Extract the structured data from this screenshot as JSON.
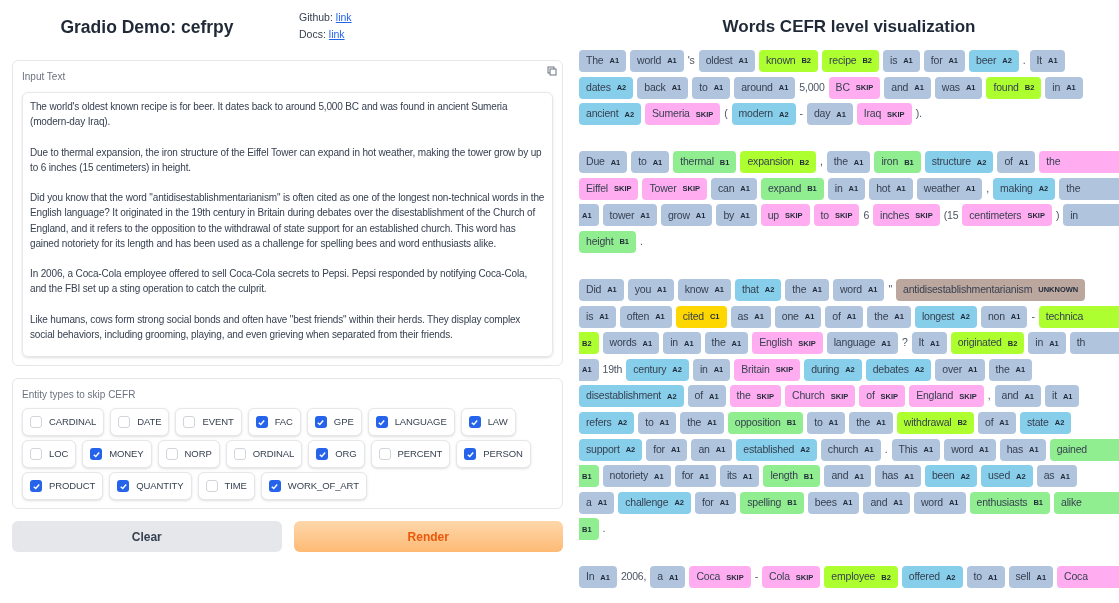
{
  "header": {
    "title": "Gradio Demo: cefrpy",
    "links": [
      {
        "label": "Github:",
        "link": "link"
      },
      {
        "label": "Docs:",
        "link": "link"
      }
    ]
  },
  "input": {
    "label": "Input Text",
    "value": "The world's oldest known recipe is for beer. It dates back to around 5,000 BC and was found in ancient Sumeria (modern-day Iraq).\n\nDue to thermal expansion, the iron structure of the Eiffel Tower can expand in hot weather, making the tower grow by up to 6 inches (15 centimeters) in height.\n\nDid you know that the word \"antidisestablishmentarianism\" is often cited as one of the longest non-technical words in the English language? It originated in the 19th century in Britain during debates over the disestablishment of the Church of England, and it refers to the opposition to the withdrawal of state support for an established church. This word has gained notoriety for its length and has been used as a challenge for spelling bees and word enthusiasts alike.\n\nIn 2006, a Coca-Cola employee offered to sell Coca-Cola secrets to Pepsi. Pepsi responded by notifying Coca-Cola, and the FBI set up a sting operation to catch the culprit.\n\nLike humans, cows form strong social bonds and often have \"best friends\" within their herds. They display complex social behaviors, including grooming, playing, and even grieving when separated from their friends."
  },
  "entities": {
    "label": "Entity types to skip CEFR",
    "options": [
      {
        "label": "CARDINAL",
        "checked": false
      },
      {
        "label": "DATE",
        "checked": false
      },
      {
        "label": "EVENT",
        "checked": false
      },
      {
        "label": "FAC",
        "checked": true
      },
      {
        "label": "GPE",
        "checked": true
      },
      {
        "label": "LANGUAGE",
        "checked": true
      },
      {
        "label": "LAW",
        "checked": true
      },
      {
        "label": "LOC",
        "checked": false
      },
      {
        "label": "MONEY",
        "checked": true
      },
      {
        "label": "NORP",
        "checked": false
      },
      {
        "label": "ORDINAL",
        "checked": false
      },
      {
        "label": "ORG",
        "checked": true
      },
      {
        "label": "PERCENT",
        "checked": false
      },
      {
        "label": "PERSON",
        "checked": true
      },
      {
        "label": "PRODUCT",
        "checked": true
      },
      {
        "label": "QUANTITY",
        "checked": true
      },
      {
        "label": "TIME",
        "checked": false
      },
      {
        "label": "WORK_OF_ART",
        "checked": true
      }
    ]
  },
  "buttons": [
    {
      "label": "Clear",
      "kind": "secondary"
    },
    {
      "label": "Render",
      "kind": "primary"
    }
  ],
  "visualization": {
    "title": "Words CEFR level visualization",
    "paragraphs": [
      {
        "lines": [
          [
            {
              "kind": "token",
              "word": "The",
              "level": "A1"
            },
            {
              "kind": "token",
              "word": "world",
              "level": "A1"
            },
            {
              "kind": "plain",
              "text": "'s"
            },
            {
              "kind": "token",
              "word": "oldest",
              "level": "A1"
            },
            {
              "kind": "token",
              "word": "known",
              "level": "B2"
            },
            {
              "kind": "token",
              "word": "recipe",
              "level": "B2"
            },
            {
              "kind": "token",
              "word": "is",
              "level": "A1"
            },
            {
              "kind": "token",
              "word": "for",
              "level": "A1"
            },
            {
              "kind": "token",
              "word": "beer",
              "level": "A2"
            },
            {
              "kind": "plain",
              "text": "."
            },
            {
              "kind": "token",
              "word": "It",
              "level": "A1"
            }
          ],
          [
            {
              "kind": "token",
              "word": "dates",
              "level": "A2"
            },
            {
              "kind": "token",
              "word": "back",
              "level": "A1"
            },
            {
              "kind": "token",
              "word": "to",
              "level": "A1"
            },
            {
              "kind": "token",
              "word": "around",
              "level": "A1"
            },
            {
              "kind": "plain",
              "text": "5,000"
            },
            {
              "kind": "token",
              "word": "BC",
              "level": "SKIP"
            },
            {
              "kind": "token",
              "word": "and",
              "level": "A1"
            },
            {
              "kind": "token",
              "word": "was",
              "level": "A1"
            },
            {
              "kind": "token",
              "word": "found",
              "level": "B2"
            },
            {
              "kind": "token",
              "word": "in",
              "level": "A1"
            }
          ],
          [
            {
              "kind": "token",
              "word": "ancient",
              "level": "A2"
            },
            {
              "kind": "token",
              "word": "Sumeria",
              "level": "SKIP"
            },
            {
              "kind": "plain",
              "text": "("
            },
            {
              "kind": "token",
              "word": "modern",
              "level": "A2"
            },
            {
              "kind": "plain",
              "text": "-"
            },
            {
              "kind": "token",
              "word": "day",
              "level": "A1"
            },
            {
              "kind": "token",
              "word": "Iraq",
              "level": "SKIP"
            },
            {
              "kind": "plain",
              "text": ")."
            }
          ]
        ]
      },
      {
        "lines": [
          [
            {
              "kind": "token",
              "word": "Due",
              "level": "A1"
            },
            {
              "kind": "token",
              "word": "to",
              "level": "A1"
            },
            {
              "kind": "token",
              "word": "thermal",
              "level": "B1"
            },
            {
              "kind": "token",
              "word": "expansion",
              "level": "B2"
            },
            {
              "kind": "plain",
              "text": ","
            },
            {
              "kind": "token",
              "word": "the",
              "level": "A1"
            },
            {
              "kind": "token",
              "word": "iron",
              "level": "B1"
            },
            {
              "kind": "token",
              "word": "structure",
              "level": "A2"
            },
            {
              "kind": "token",
              "word": "of",
              "level": "A1"
            },
            {
              "kind": "token_start",
              "word": "the",
              "color": "#ffadf0"
            }
          ],
          [
            {
              "kind": "token",
              "word": "Eiffel",
              "level": "SKIP"
            },
            {
              "kind": "token",
              "word": "Tower",
              "level": "SKIP"
            },
            {
              "kind": "token",
              "word": "can",
              "level": "A1"
            },
            {
              "kind": "token",
              "word": "expand",
              "level": "B1"
            },
            {
              "kind": "token",
              "word": "in",
              "level": "A1"
            },
            {
              "kind": "token",
              "word": "hot",
              "level": "A1"
            },
            {
              "kind": "token",
              "word": "weather",
              "level": "A1"
            },
            {
              "kind": "plain",
              "text": ","
            },
            {
              "kind": "token",
              "word": "making",
              "level": "A2"
            },
            {
              "kind": "token_start",
              "word": "the",
              "color": "#b0c4de"
            }
          ],
          [
            {
              "kind": "token_end",
              "level": "A1"
            },
            {
              "kind": "token",
              "word": "tower",
              "level": "A1"
            },
            {
              "kind": "token",
              "word": "grow",
              "level": "A1"
            },
            {
              "kind": "token",
              "word": "by",
              "level": "A1"
            },
            {
              "kind": "token",
              "word": "up",
              "level": "SKIP"
            },
            {
              "kind": "token",
              "word": "to",
              "level": "SKIP"
            },
            {
              "kind": "plain",
              "text": "6"
            },
            {
              "kind": "token",
              "word": "inches",
              "level": "SKIP"
            },
            {
              "kind": "plain",
              "text": "(15"
            },
            {
              "kind": "token",
              "word": "centimeters",
              "level": "SKIP"
            },
            {
              "kind": "plain",
              "text": ")"
            },
            {
              "kind": "token_start",
              "word": "in",
              "color": "#b0c4de"
            }
          ],
          [
            {
              "kind": "token",
              "word": "height",
              "level": "B1"
            },
            {
              "kind": "plain",
              "text": "."
            }
          ]
        ]
      },
      {
        "lines": [
          [
            {
              "kind": "token",
              "word": "Did",
              "level": "A1"
            },
            {
              "kind": "token",
              "word": "you",
              "level": "A1"
            },
            {
              "kind": "token",
              "word": "know",
              "level": "A1"
            },
            {
              "kind": "token",
              "word": "that",
              "level": "A2"
            },
            {
              "kind": "token",
              "word": "the",
              "level": "A1"
            },
            {
              "kind": "token",
              "word": "word",
              "level": "A1"
            },
            {
              "kind": "plain",
              "text": "\""
            },
            {
              "kind": "token",
              "word": "antidisestablishmentarianism",
              "level": "UNKNOWN"
            }
          ],
          [
            {
              "kind": "token",
              "word": "is",
              "level": "A1"
            },
            {
              "kind": "token",
              "word": "often",
              "level": "A1"
            },
            {
              "kind": "token",
              "word": "cited",
              "level": "C1"
            },
            {
              "kind": "token",
              "word": "as",
              "level": "A1"
            },
            {
              "kind": "token",
              "word": "one",
              "level": "A1"
            },
            {
              "kind": "token",
              "word": "of",
              "level": "A1"
            },
            {
              "kind": "token",
              "word": "the",
              "level": "A1"
            },
            {
              "kind": "token",
              "word": "longest",
              "level": "A2"
            },
            {
              "kind": "token",
              "word": "non",
              "level": "A1"
            },
            {
              "kind": "plain",
              "text": "-"
            },
            {
              "kind": "token_start",
              "word": "technica",
              "color": "#adff2f"
            }
          ],
          [
            {
              "kind": "token_end",
              "level": "B2"
            },
            {
              "kind": "token",
              "word": "words",
              "level": "A1"
            },
            {
              "kind": "token",
              "word": "in",
              "level": "A1"
            },
            {
              "kind": "token",
              "word": "the",
              "level": "A1"
            },
            {
              "kind": "token",
              "word": "English",
              "level": "SKIP"
            },
            {
              "kind": "token",
              "word": "language",
              "level": "A1"
            },
            {
              "kind": "plain",
              "text": "?"
            },
            {
              "kind": "token",
              "word": "It",
              "level": "A1"
            },
            {
              "kind": "token",
              "word": "originated",
              "level": "B2"
            },
            {
              "kind": "token",
              "word": "in",
              "level": "A1"
            },
            {
              "kind": "token_start",
              "word": "th",
              "color": "#b0c4de"
            }
          ],
          [
            {
              "kind": "token_end",
              "level": "A1"
            },
            {
              "kind": "plain",
              "text": "19th"
            },
            {
              "kind": "token",
              "word": "century",
              "level": "A2"
            },
            {
              "kind": "token",
              "word": "in",
              "level": "A1"
            },
            {
              "kind": "token",
              "word": "Britain",
              "level": "SKIP"
            },
            {
              "kind": "token",
              "word": "during",
              "level": "A2"
            },
            {
              "kind": "token",
              "word": "debates",
              "level": "A2"
            },
            {
              "kind": "token",
              "word": "over",
              "level": "A1"
            },
            {
              "kind": "token",
              "word": "the",
              "level": "A1"
            }
          ],
          [
            {
              "kind": "token",
              "word": "disestablishment",
              "level": "A2"
            },
            {
              "kind": "token",
              "word": "of",
              "level": "A1"
            },
            {
              "kind": "token",
              "word": "the",
              "level": "SKIP"
            },
            {
              "kind": "token",
              "word": "Church",
              "level": "SKIP"
            },
            {
              "kind": "token",
              "word": "of",
              "level": "SKIP"
            },
            {
              "kind": "token",
              "word": "England",
              "level": "SKIP"
            },
            {
              "kind": "plain",
              "text": ","
            },
            {
              "kind": "token",
              "word": "and",
              "level": "A1"
            },
            {
              "kind": "token",
              "word": "it",
              "level": "A1"
            }
          ],
          [
            {
              "kind": "token",
              "word": "refers",
              "level": "A2"
            },
            {
              "kind": "token",
              "word": "to",
              "level": "A1"
            },
            {
              "kind": "token",
              "word": "the",
              "level": "A1"
            },
            {
              "kind": "token",
              "word": "opposition",
              "level": "B1"
            },
            {
              "kind": "token",
              "word": "to",
              "level": "A1"
            },
            {
              "kind": "token",
              "word": "the",
              "level": "A1"
            },
            {
              "kind": "token",
              "word": "withdrawal",
              "level": "B2"
            },
            {
              "kind": "token",
              "word": "of",
              "level": "A1"
            },
            {
              "kind": "token",
              "word": "state",
              "level": "A2"
            }
          ],
          [
            {
              "kind": "token",
              "word": "support",
              "level": "A2"
            },
            {
              "kind": "token",
              "word": "for",
              "level": "A1"
            },
            {
              "kind": "token",
              "word": "an",
              "level": "A1"
            },
            {
              "kind": "token",
              "word": "established",
              "level": "A2"
            },
            {
              "kind": "token",
              "word": "church",
              "level": "A1"
            },
            {
              "kind": "plain",
              "text": "."
            },
            {
              "kind": "token",
              "word": "This",
              "level": "A1"
            },
            {
              "kind": "token",
              "word": "word",
              "level": "A1"
            },
            {
              "kind": "token",
              "word": "has",
              "level": "A1"
            },
            {
              "kind": "token_start",
              "word": "gained",
              "color": "#90ee90"
            }
          ],
          [
            {
              "kind": "token_end",
              "level": "B1"
            },
            {
              "kind": "token",
              "word": "notoriety",
              "level": "A1"
            },
            {
              "kind": "token",
              "word": "for",
              "level": "A1"
            },
            {
              "kind": "token",
              "word": "its",
              "level": "A1"
            },
            {
              "kind": "token",
              "word": "length",
              "level": "B1"
            },
            {
              "kind": "token",
              "word": "and",
              "level": "A1"
            },
            {
              "kind": "token",
              "word": "has",
              "level": "A1"
            },
            {
              "kind": "token",
              "word": "been",
              "level": "A2"
            },
            {
              "kind": "token",
              "word": "used",
              "level": "A2"
            },
            {
              "kind": "token",
              "word": "as",
              "level": "A1"
            }
          ],
          [
            {
              "kind": "token",
              "word": "a",
              "level": "A1"
            },
            {
              "kind": "token",
              "word": "challenge",
              "level": "A2"
            },
            {
              "kind": "token",
              "word": "for",
              "level": "A1"
            },
            {
              "kind": "token",
              "word": "spelling",
              "level": "B1"
            },
            {
              "kind": "token",
              "word": "bees",
              "level": "A1"
            },
            {
              "kind": "token",
              "word": "and",
              "level": "A1"
            },
            {
              "kind": "token",
              "word": "word",
              "level": "A1"
            },
            {
              "kind": "token",
              "word": "enthusiasts",
              "level": "B1"
            },
            {
              "kind": "token_start",
              "word": "alike",
              "color": "#90ee90"
            }
          ],
          [
            {
              "kind": "token_end",
              "level": "B1"
            },
            {
              "kind": "plain",
              "text": "."
            }
          ]
        ]
      },
      {
        "lines": [
          [
            {
              "kind": "token",
              "word": "In",
              "level": "A1"
            },
            {
              "kind": "plain",
              "text": "2006,"
            },
            {
              "kind": "token",
              "word": "a",
              "level": "A1"
            },
            {
              "kind": "token",
              "word": "Coca",
              "level": "SKIP"
            },
            {
              "kind": "plain",
              "text": "-"
            },
            {
              "kind": "token",
              "word": "Cola",
              "level": "SKIP"
            },
            {
              "kind": "token",
              "word": "employee",
              "level": "B2"
            },
            {
              "kind": "token",
              "word": "offered",
              "level": "A2"
            },
            {
              "kind": "token",
              "word": "to",
              "level": "A1"
            },
            {
              "kind": "token",
              "word": "sell",
              "level": "A1"
            },
            {
              "kind": "token_start",
              "word": "Coca",
              "color": "#ffadf0"
            }
          ]
        ]
      }
    ]
  }
}
